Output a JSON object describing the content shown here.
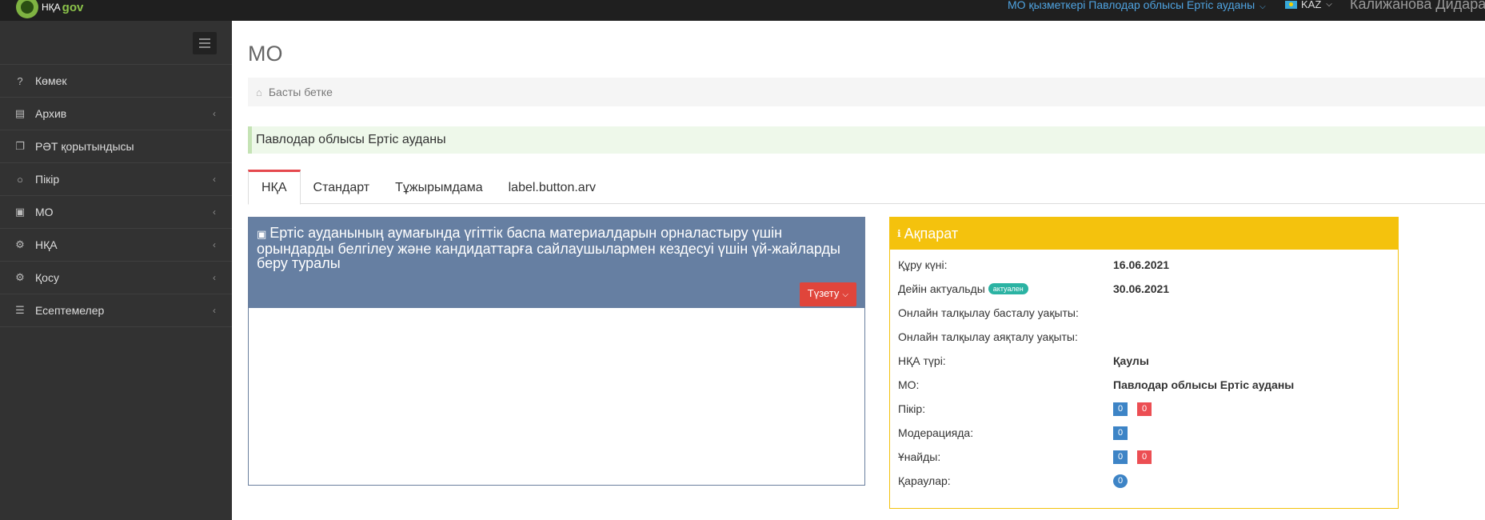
{
  "brand": {
    "part1": "НҚА",
    "part2": "gov"
  },
  "topbar": {
    "employee": "МО қызметкері Павлодар облысы Ертіс ауданы",
    "lang": "KAZ",
    "user": "Калижанова Дидара"
  },
  "sidebar": {
    "items": [
      {
        "label": "Көмек",
        "icon": "question-icon",
        "glyph": "?",
        "has_arrow": false
      },
      {
        "label": "Архив",
        "icon": "archive-icon",
        "glyph": "▤",
        "has_arrow": true
      },
      {
        "label": "РӘТ қорытындысы",
        "icon": "copy-icon",
        "glyph": "❐",
        "has_arrow": false
      },
      {
        "label": "Пікір",
        "icon": "comment-icon",
        "glyph": "○",
        "has_arrow": true
      },
      {
        "label": "МО",
        "icon": "briefcase-icon",
        "glyph": "▣",
        "has_arrow": true
      },
      {
        "label": "НҚА",
        "icon": "gear-icon",
        "glyph": "⚙",
        "has_arrow": true
      },
      {
        "label": "Қосу",
        "icon": "gear-icon",
        "glyph": "⚙",
        "has_arrow": true
      },
      {
        "label": "Есептемелер",
        "icon": "list-icon",
        "glyph": "☰",
        "has_arrow": true
      }
    ]
  },
  "main": {
    "title": "МО",
    "breadcrumb": "Басты бетке",
    "alert": "Павлодар облысы Ертіс ауданы",
    "tabs": [
      "НҚА",
      "Стандарт",
      "Тұжырымдама",
      "label.button.arv"
    ],
    "active_tab": 0
  },
  "document": {
    "title": "Ертіс ауданының аумағында үгіттік баспа материалдарын орналастыру үшін орындарды белгілеу және кандидаттарға сайлаушылармен кездесуі үшін үй-жайларды беру туралы",
    "edit_label": "Түзету"
  },
  "info": {
    "header": "Ақпарат",
    "created_label": "Құру күні:",
    "created_value": "16.06.2021",
    "actual_label": "Дейін актуальды",
    "actual_badge": "актуален",
    "actual_value": "30.06.2021",
    "online_start_label": "Онлайн талқылау басталу уақыты:",
    "online_end_label": "Онлайн талқылау аяқталу уақыты:",
    "type_label": "НҚА түрі:",
    "type_value": "Қаулы",
    "mo_label": "МО:",
    "mo_value": "Павлодар облысы Ертіс ауданы",
    "comments_label": "Пікір:",
    "comments_blue": "0",
    "comments_red": "0",
    "moderation_label": "Модерацияда:",
    "moderation_value": "0",
    "likes_label": "Ұнайды:",
    "likes_blue": "0",
    "likes_red": "0",
    "views_label": "Қараулар:",
    "views_value": "0"
  },
  "colors": {
    "sidebar": "#323232",
    "doc_header": "#667fa2",
    "info_header": "#f4c20d",
    "edit_button": "#e0453b",
    "active_tab": "#e5484d"
  }
}
